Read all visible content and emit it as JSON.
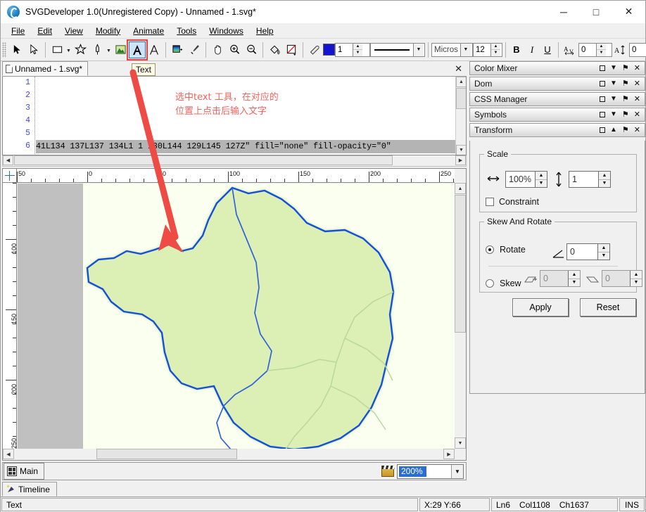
{
  "window": {
    "title": "SVGDeveloper 1.0(Unregistered Copy) - Unnamed - 1.svg*",
    "app_icon": "svg-developer-logo-icon",
    "minimize": "─",
    "maximize": "□",
    "close": "✕"
  },
  "menubar": {
    "items": [
      {
        "label": "File"
      },
      {
        "label": "Edit"
      },
      {
        "label": "View"
      },
      {
        "label": "Modify"
      },
      {
        "label": "Animate"
      },
      {
        "label": "Tools"
      },
      {
        "label": "Windows"
      },
      {
        "label": "Help"
      }
    ]
  },
  "toolbar": {
    "tools": [
      {
        "name": "select-arrow-tool",
        "glyph": "➤"
      },
      {
        "name": "direct-select-tool",
        "glyph": "➤"
      },
      {
        "name": "rectangle-tool",
        "glyph": "▭"
      },
      {
        "name": "star-tool",
        "glyph": "☆"
      },
      {
        "name": "pen-tool",
        "glyph": "✐"
      },
      {
        "name": "image-tool",
        "glyph": "⛰"
      },
      {
        "name": "text-tool",
        "glyph": "A"
      },
      {
        "name": "text-outline-tool",
        "glyph": "A"
      },
      {
        "name": "gradient-tool",
        "glyph": "▤"
      },
      {
        "name": "eyedropper-tool",
        "glyph": "✐"
      },
      {
        "name": "hand-tool",
        "glyph": "✋"
      },
      {
        "name": "zoom-in-tool",
        "glyph": "⊕"
      },
      {
        "name": "zoom-out-tool",
        "glyph": "⊖"
      },
      {
        "name": "paint-bucket-tool",
        "glyph": "◢"
      },
      {
        "name": "no-stroke-tool",
        "glyph": "◱"
      },
      {
        "name": "eraser-tool",
        "glyph": "✑"
      }
    ],
    "active_tool": "text-tool",
    "fill_color": "#1414d0",
    "stroke_width": "1",
    "stroke_style": "solid-line",
    "font_family": "Micros",
    "font_size": "12",
    "bold_label": "B",
    "italic_label": "I",
    "underline_label": "U",
    "letter_spacing": "0",
    "line_spacing": "0"
  },
  "tooltip": {
    "text": "Text"
  },
  "document_tab": {
    "label": "Unnamed - 1.svg*",
    "close_glyph": "✕"
  },
  "editor": {
    "line_numbers": [
      "1",
      "2",
      "3",
      "4",
      "5",
      "6"
    ],
    "selected_line_text": "41L134 137L137 134L1 1 130L144 129L145 127Z\" fill=\"none\" fill-opacity=\"0\"",
    "scroll_up": "▲",
    "scroll_down": "▼",
    "scroll_left": "◀",
    "scroll_right": "▶"
  },
  "annotation": {
    "text": "选中text 工具，在对应的\n位置上点击后输入文字",
    "color": "#f4625c",
    "arrow_color": "#ee4b44"
  },
  "canvas": {
    "h_ruler_labels": [
      "50",
      "0",
      "50",
      "100",
      "150",
      "200",
      "250"
    ],
    "v_ruler_labels": [
      "100",
      "150",
      "200",
      "250"
    ],
    "map_fill": "#d7ecb0",
    "map_border_blue": "#1450d8",
    "map_border_green": "#4fa02a",
    "page_background": "#fbfff0"
  },
  "scene_bar": {
    "scene_label": "Main",
    "scene_icon": "scene-grid-icon",
    "clapper_icon": "clapper-board-icon",
    "zoom_value": "200%",
    "zoom_drop_glyph": "▼"
  },
  "timeline": {
    "label": "Timeline",
    "icon": "timeline-icon"
  },
  "statusbar": {
    "mode": "Text",
    "coords": "X:29  Y:66",
    "ln": "Ln6",
    "col": "Col1108",
    "ch": "Ch1637",
    "ins": "INS"
  },
  "dock": {
    "panels": [
      {
        "title": "Color Mixer",
        "collapse_glyph": "▼"
      },
      {
        "title": "Dom",
        "collapse_glyph": "▼"
      },
      {
        "title": "CSS Manager",
        "collapse_glyph": "▼"
      },
      {
        "title": "Symbols",
        "collapse_glyph": "▼"
      },
      {
        "title": "Transform",
        "collapse_glyph": "▲"
      }
    ],
    "panel_buttons": {
      "restore": "□",
      "pin": "⚑",
      "close": "✕"
    },
    "transform": {
      "scale_legend": "Scale",
      "scale_x_value": "100%",
      "scale_y_value": "1",
      "constraint_label": "Constraint",
      "skew_legend": "Skew And Rotate",
      "rotate_label": "Rotate",
      "rotate_value": "0",
      "skew_label": "Skew",
      "skew_x_value": "0",
      "skew_y_value": "0",
      "apply_label": "Apply",
      "reset_label": "Reset"
    }
  }
}
